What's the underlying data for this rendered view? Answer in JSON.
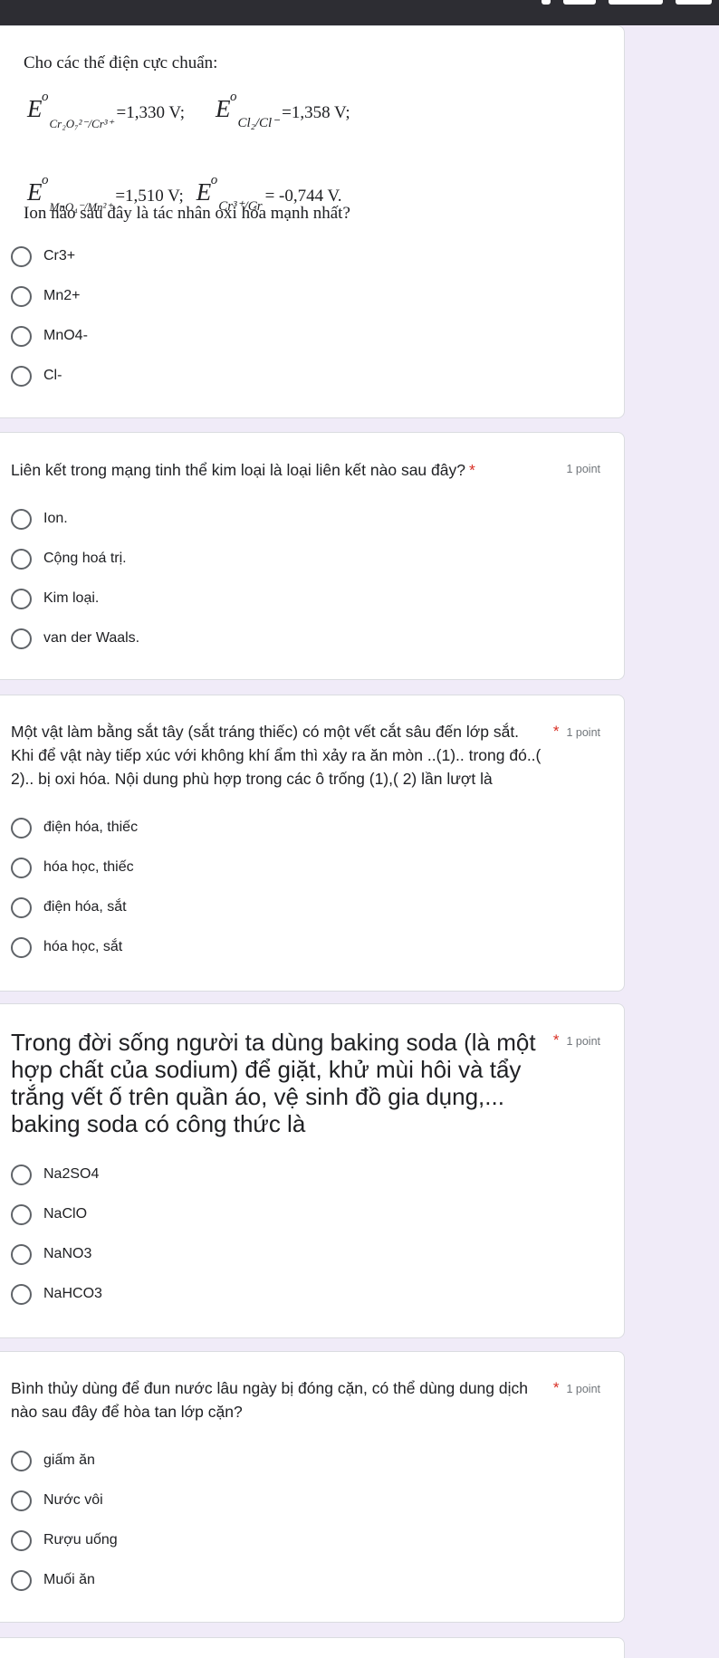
{
  "q1": {
    "intro": "Cho các thế điện cực chuẩn:",
    "eq1_sub": "Cr₂O₇²⁻/Cr³⁺",
    "eq1_val": "=1,330 V;",
    "eq2_sub": "Cl₂/Cl⁻",
    "eq2_val": "=1,358 V;",
    "eq3_sub": "MnO₄⁻/Mn²⁺",
    "eq3_val": "=1,510 V;",
    "eq4_sub": "Cr³⁺/Cr",
    "eq4_val": "= -0,744 V.",
    "question": "Ion nào sau đây là tác nhân oxi hóa mạnh nhất?",
    "options": [
      "Cr3+",
      "Mn2+",
      "MnO4-",
      "Cl-"
    ]
  },
  "q2": {
    "title": "Liên kết trong mạng tinh thể kim loại là loại liên kết nào sau đây?",
    "required": "*",
    "points": "1 point",
    "options": [
      "Ion.",
      "Cộng hoá trị.",
      "Kim loại.",
      "van der Waals."
    ]
  },
  "q3": {
    "title_line1": "Một vật làm bằng sắt tây (sắt tráng thiếc) có một vết cắt sâu đến lớp sắt.",
    "title_line2": "Khi để vật này tiếp xúc với không khí ẩm thì xảy ra ăn mòn ..(1).. trong đó..(",
    "title_line3": "2).. bị oxi hóa. Nội dung phù hợp trong các ô trống (1),( 2) lần lượt là",
    "required": "*",
    "points": "1 point",
    "options": [
      "điện hóa, thiếc",
      "hóa học, thiếc",
      "điện hóa, sắt",
      "hóa học, sắt"
    ]
  },
  "q4": {
    "title_line1": "Trong đời sống người ta dùng baking soda (là một",
    "title_line2": "hợp chất của sodium) để giặt, khử mùi hôi và tẩy",
    "title_line3": "trắng vết ố trên quần áo, vệ sinh đồ gia dụng,...",
    "title_line4": "baking soda có công thức là",
    "required": "*",
    "points": "1 point",
    "options": [
      "Na2SO4",
      "NaClO",
      "NaNO3",
      "NaHCO3"
    ]
  },
  "q5": {
    "title_line1": "Bình thủy dùng để đun nước lâu ngày bị đóng cặn, có thể dùng dung dịch",
    "title_line2": "nào sau đây để hòa tan lớp cặn?",
    "required": "*",
    "points": "1 point",
    "options": [
      "giấm ăn",
      "Nước vôi",
      "Rượu uống",
      "Muối ăn"
    ]
  }
}
